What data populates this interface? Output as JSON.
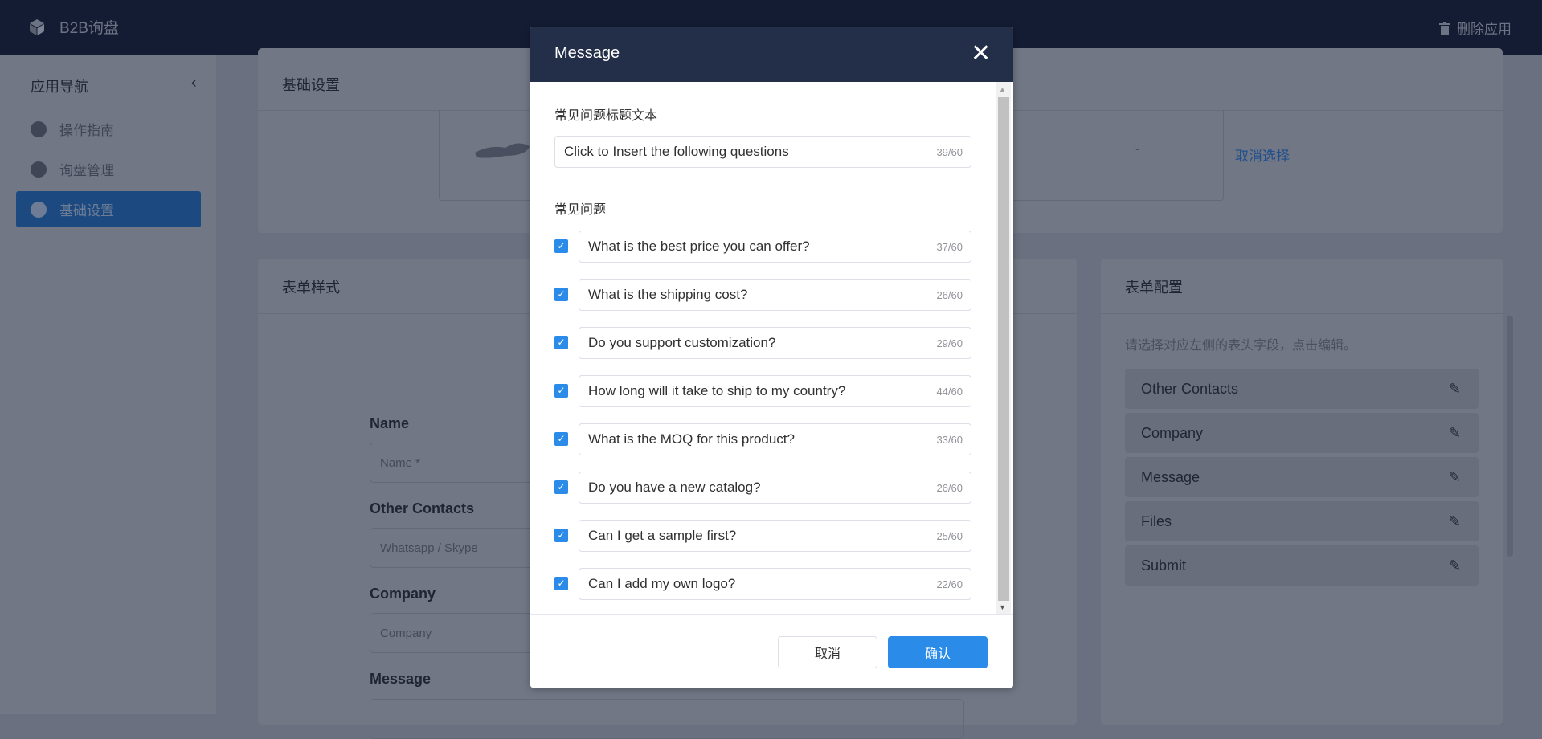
{
  "topbar": {
    "app_name": "B2B询盘",
    "delete_app": "删除应用"
  },
  "sidebar": {
    "title": "应用导航",
    "items": [
      {
        "label": "操作指南",
        "icon": "navigation-icon"
      },
      {
        "label": "询盘管理",
        "icon": "chat-icon"
      },
      {
        "label": "基础设置",
        "icon": "gear-icon",
        "active": true
      }
    ]
  },
  "basic_settings": {
    "title": "基础设置",
    "price_placeholder": "-",
    "deselect": "取消选择"
  },
  "form_style": {
    "title": "表单样式",
    "fields": [
      {
        "label": "Name",
        "placeholder": "Name *"
      },
      {
        "label": "Other Contacts",
        "placeholder": "Whatsapp / Skype"
      },
      {
        "label": "Company",
        "placeholder": "Company"
      },
      {
        "label": "Message",
        "placeholder": ""
      }
    ]
  },
  "form_config": {
    "title": "表单配置",
    "hint": "请选择对应左侧的表头字段，点击编辑。",
    "items": [
      "Other Contacts",
      "Company",
      "Message",
      "Files",
      "Submit"
    ]
  },
  "modal": {
    "title": "Message",
    "faq_title_label": "常见问题标题文本",
    "faq_title_value": "Click to Insert the following questions",
    "faq_title_count": "39/60",
    "faq_label": "常见问题",
    "questions": [
      {
        "text": "What is the best price you can offer?",
        "count": "37/60",
        "checked": true
      },
      {
        "text": "What is the shipping cost?",
        "count": "26/60",
        "checked": true
      },
      {
        "text": "Do you support customization?",
        "count": "29/60",
        "checked": true
      },
      {
        "text": "How long will it take to ship to my country?",
        "count": "44/60",
        "checked": true
      },
      {
        "text": "What is the MOQ for this product?",
        "count": "33/60",
        "checked": true
      },
      {
        "text": "Do you have a new catalog?",
        "count": "26/60",
        "checked": true
      },
      {
        "text": "Can I get a sample first?",
        "count": "25/60",
        "checked": true
      },
      {
        "text": "Can I add my own logo?",
        "count": "22/60",
        "checked": true
      }
    ],
    "cancel": "取消",
    "confirm": "确认"
  },
  "colors": {
    "accent": "#2a8be8",
    "header": "#141c33",
    "modal_header": "#232e48"
  }
}
